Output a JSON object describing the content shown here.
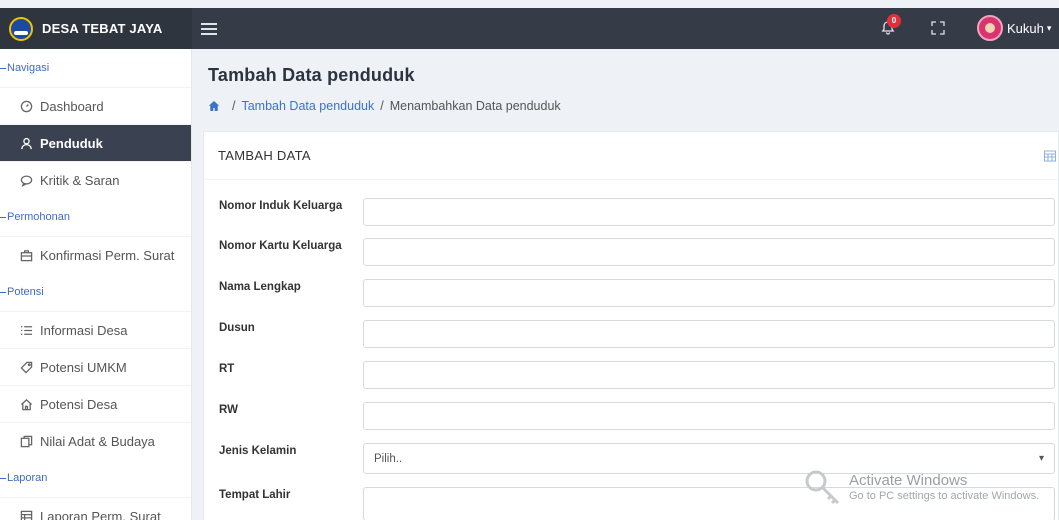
{
  "topbar": {
    "brand": "DESA TEBAT JAYA",
    "notification_count": "0",
    "user_name": "Kukuh"
  },
  "sidebar": {
    "sections": [
      {
        "label": "Navigasi"
      },
      {
        "label": "Permohonan"
      },
      {
        "label": "Potensi"
      },
      {
        "label": "Laporan"
      }
    ],
    "items": [
      {
        "label": "Dashboard",
        "icon": "gauge-icon"
      },
      {
        "label": "Penduduk",
        "icon": "user-icon",
        "active": true
      },
      {
        "label": "Kritik & Saran",
        "icon": "chat-icon"
      },
      {
        "label": "Konfirmasi Perm. Surat",
        "icon": "briefcase-icon"
      },
      {
        "label": "Informasi Desa",
        "icon": "list-icon"
      },
      {
        "label": "Potensi UMKM",
        "icon": "tag-icon"
      },
      {
        "label": "Potensi Desa",
        "icon": "home-icon"
      },
      {
        "label": "Nilai Adat & Budaya",
        "icon": "copy-icon"
      },
      {
        "label": "Laporan Perm. Surat",
        "icon": "report-icon"
      }
    ]
  },
  "main": {
    "page_title": "Tambah Data penduduk",
    "breadcrumb": {
      "separator": "/",
      "link": "Tambah Data penduduk",
      "current": "Menambahkan Data penduduk"
    },
    "card_title": "TAMBAH DATA",
    "form": {
      "nik_label": "Nomor Induk Keluarga",
      "nkk_label": "Nomor Kartu Keluarga",
      "nama_label": "Nama Lengkap",
      "dusun_label": "Dusun",
      "rt_label": "RT",
      "rw_label": "RW",
      "jk_label": "Jenis Kelamin",
      "jk_value": "Pilih..",
      "tempat_lahir_label": "Tempat Lahir"
    }
  },
  "watermark": {
    "title": "Activate Windows",
    "subtitle": "Go to PC settings to activate Windows."
  },
  "colors": {
    "topbar": "#353c48",
    "active_nav": "#3a4150",
    "accent": "#3d72c9",
    "badge": "#e0313a"
  }
}
